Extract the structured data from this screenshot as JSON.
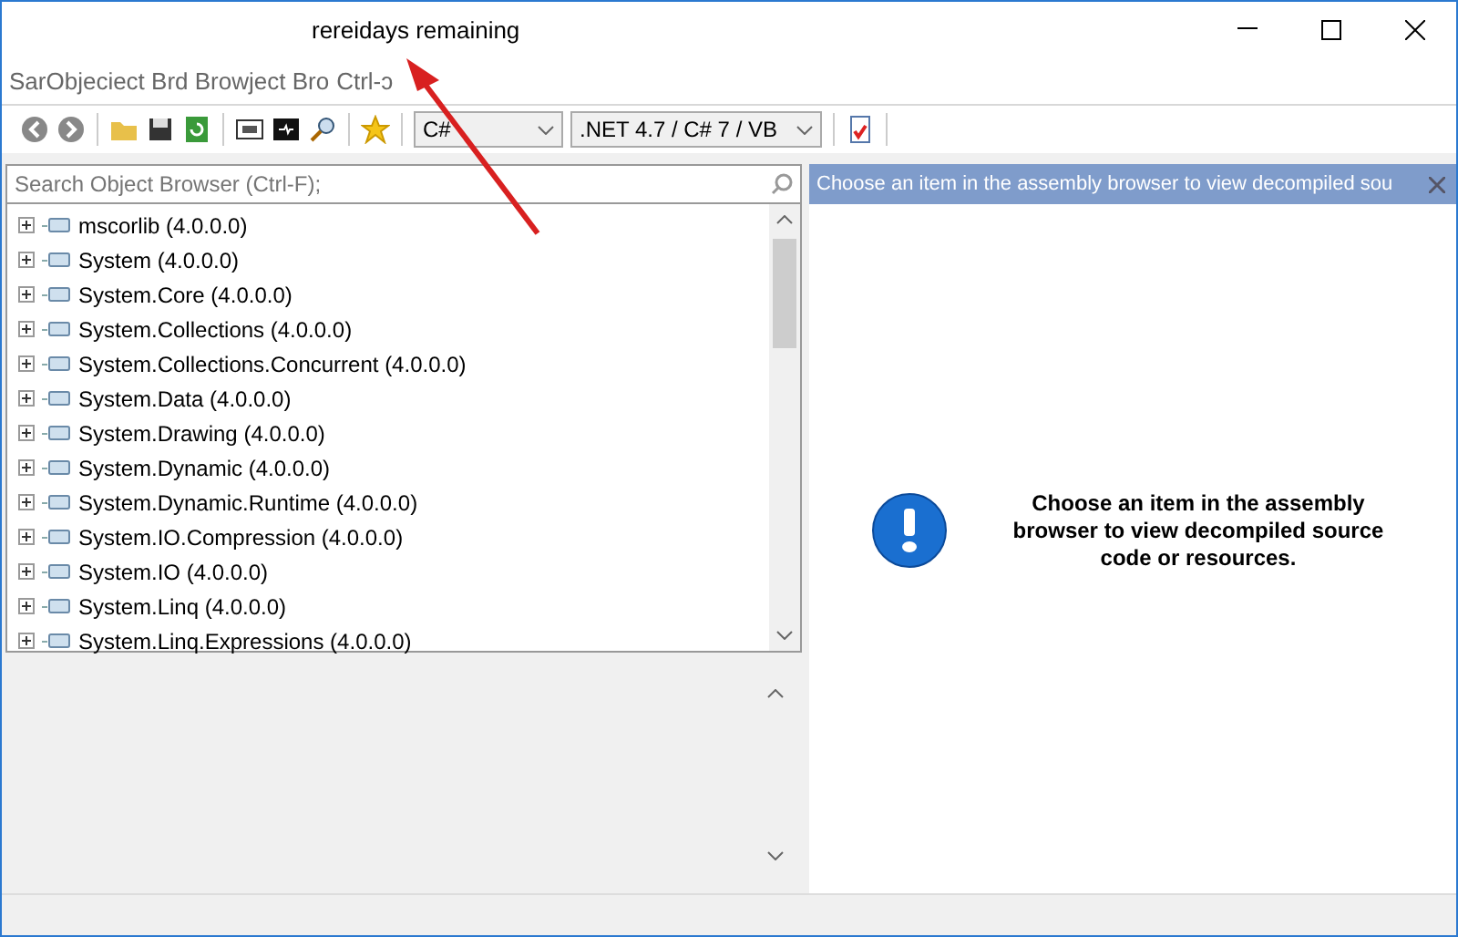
{
  "window": {
    "title": "rereidays remaining"
  },
  "menu_text": "SarObjeciect Brd Browject Bro",
  "menu_hint": "Ctrl-ɔ",
  "toolbar": {
    "language": "C#",
    "version": ".NET 4.7 / C# 7 / VB"
  },
  "search": {
    "placeholder": "Search Object Browser (Ctrl-F);"
  },
  "assemblies": [
    {
      "label": "mscorlib (4.0.0.0)",
      "expanded": false
    },
    {
      "label": "System (4.0.0.0)",
      "expanded": false
    },
    {
      "label": "System.Core (4.0.0.0)",
      "expanded": false
    },
    {
      "label": "System.Collections (4.0.0.0)",
      "expanded": false
    },
    {
      "label": "System.Collections.Concurrent (4.0.0.0)",
      "expanded": false
    },
    {
      "label": "System.Data (4.0.0.0)",
      "expanded": false
    },
    {
      "label": "System.Drawing (4.0.0.0)",
      "expanded": false
    },
    {
      "label": "System.Dynamic (4.0.0.0)",
      "expanded": false
    },
    {
      "label": "System.Dynamic.Runtime (4.0.0.0)",
      "expanded": false
    },
    {
      "label": "System.IO.Compression (4.0.0.0)",
      "expanded": false
    },
    {
      "label": "System.IO (4.0.0.0)",
      "expanded": false
    },
    {
      "label": "System.Linq (4.0.0.0)",
      "expanded": false
    },
    {
      "label": "System.Linq.Expressions (4.0.0.0)",
      "expanded": false
    }
  ],
  "tab_header": {
    "title": "Choose an item in the assembly browser to view decompiled sou"
  },
  "message": "Choose an item in the assembly browser to view decompiled source code or resources."
}
